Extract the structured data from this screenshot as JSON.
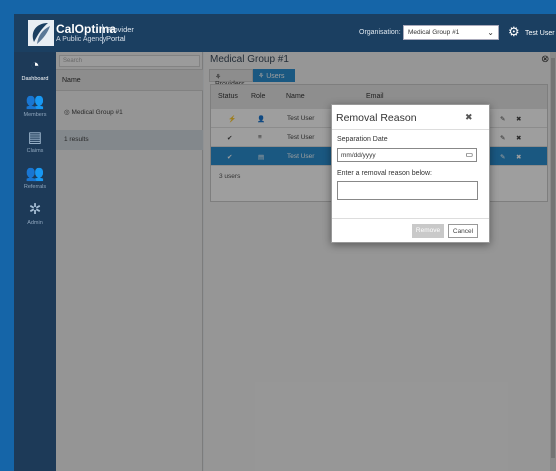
{
  "brand": {
    "name": "CalOptima",
    "tagline": "A Public Agency",
    "portal": "Provider Portal",
    "logo_icon": "caloptima-logo"
  },
  "header": {
    "organisation_label": "Organisation:",
    "organisation_value": "Medical Group #1",
    "settings_icon": "gear-icon",
    "user_menu": "Test User ▾"
  },
  "sidebar": {
    "items": [
      {
        "label": "Dashboard",
        "icon": "gauge-icon",
        "glyph": "◔"
      },
      {
        "label": "Members",
        "icon": "members-icon",
        "glyph": "👥"
      },
      {
        "label": "Claims",
        "icon": "claims-icon",
        "glyph": "▤"
      },
      {
        "label": "Referrals",
        "icon": "referrals-icon",
        "glyph": "👥"
      },
      {
        "label": "Admin",
        "icon": "cogs-icon",
        "glyph": "✲"
      }
    ]
  },
  "list_panel": {
    "search_placeholder": "Search",
    "column_header": "Name",
    "rows": [
      "◎ Medical Group #1"
    ],
    "results_text": "1 results"
  },
  "main": {
    "title": "Medical Group #1",
    "tabs": [
      {
        "label": "⚘ Providers"
      },
      {
        "label": "⚘ Users"
      }
    ],
    "grid_headers": {
      "status": "Status",
      "role": "Role",
      "name": "Name",
      "email": "Email"
    },
    "grid_rows": [
      {
        "status": "⚡",
        "role": "👤",
        "name": "Test User"
      },
      {
        "status": "✔",
        "role": "≡",
        "name": "Test User"
      },
      {
        "status": "✔",
        "role": "▤",
        "name": "Test User"
      }
    ],
    "row_actions": {
      "edit": "✎",
      "delete": "✖"
    },
    "users_count": "3 users"
  },
  "modal": {
    "title": "Removal Reason",
    "close": "✖",
    "separation_label": "Separation Date",
    "date_placeholder": "mm/dd/yyyy",
    "reason_label": "Enter a removal reason below:",
    "reason_value": "",
    "remove_button": "Remove",
    "cancel_button": "Cancel"
  },
  "colors": {
    "background": "#1565a8",
    "topbar": "#1b3f61",
    "sidebar": "#1d3a58",
    "accent": "#2a8fd0"
  }
}
